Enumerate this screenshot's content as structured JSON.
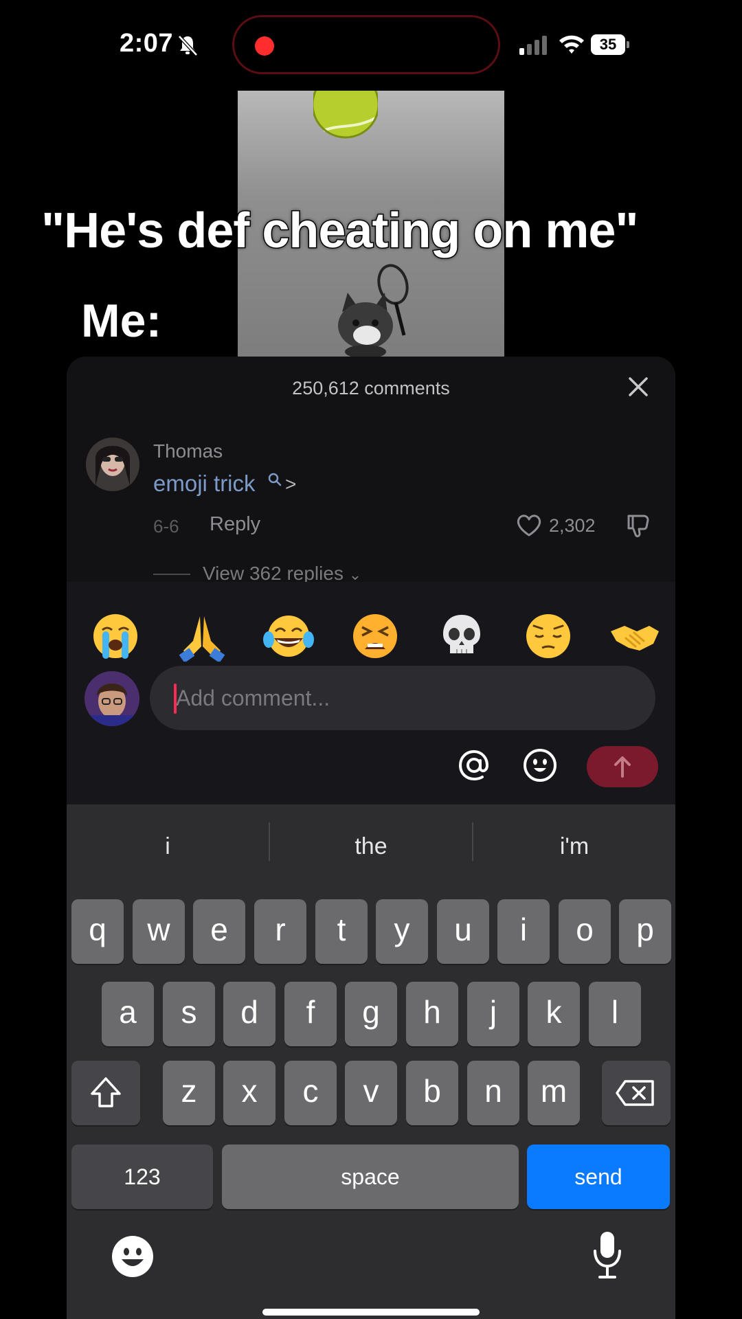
{
  "status_bar": {
    "time": "2:07",
    "battery": "35",
    "icons": [
      "bell-slash-icon",
      "record-dot-icon",
      "cellular-signal-icon",
      "wifi-icon",
      "battery-icon"
    ]
  },
  "video": {
    "caption_line1": "\"He's def cheating on me\"",
    "caption_line2": "Me:"
  },
  "comments": {
    "count_label": "250,612 comments",
    "close_icon": "close-icon",
    "top_comment": {
      "author": "Thomas",
      "text": "emoji trick",
      "search_chevron": ">",
      "date": "6-6",
      "reply_label": "Reply",
      "likes": "2,302",
      "view_replies_label": "View 362 replies"
    }
  },
  "quick_emojis": [
    "loudly-crying-face",
    "folded-hands",
    "face-with-tears-of-joy",
    "tired-face",
    "skull",
    "pensive-face",
    "handshake"
  ],
  "composer": {
    "placeholder": "Add comment...",
    "mention_icon": "at-sign-icon",
    "emoji_icon": "smiley-icon",
    "post_icon": "arrow-up-icon",
    "accent": "#fe2c55"
  },
  "keyboard": {
    "suggestions": [
      "i",
      "the",
      "i'm"
    ],
    "rows": [
      [
        "q",
        "w",
        "e",
        "r",
        "t",
        "y",
        "u",
        "i",
        "o",
        "p"
      ],
      [
        "a",
        "s",
        "d",
        "f",
        "g",
        "h",
        "j",
        "k",
        "l"
      ],
      [
        "z",
        "x",
        "c",
        "v",
        "b",
        "n",
        "m"
      ]
    ],
    "numbers_label": "123",
    "space_label": "space",
    "send_label": "send",
    "send_color": "#0a7aff"
  }
}
